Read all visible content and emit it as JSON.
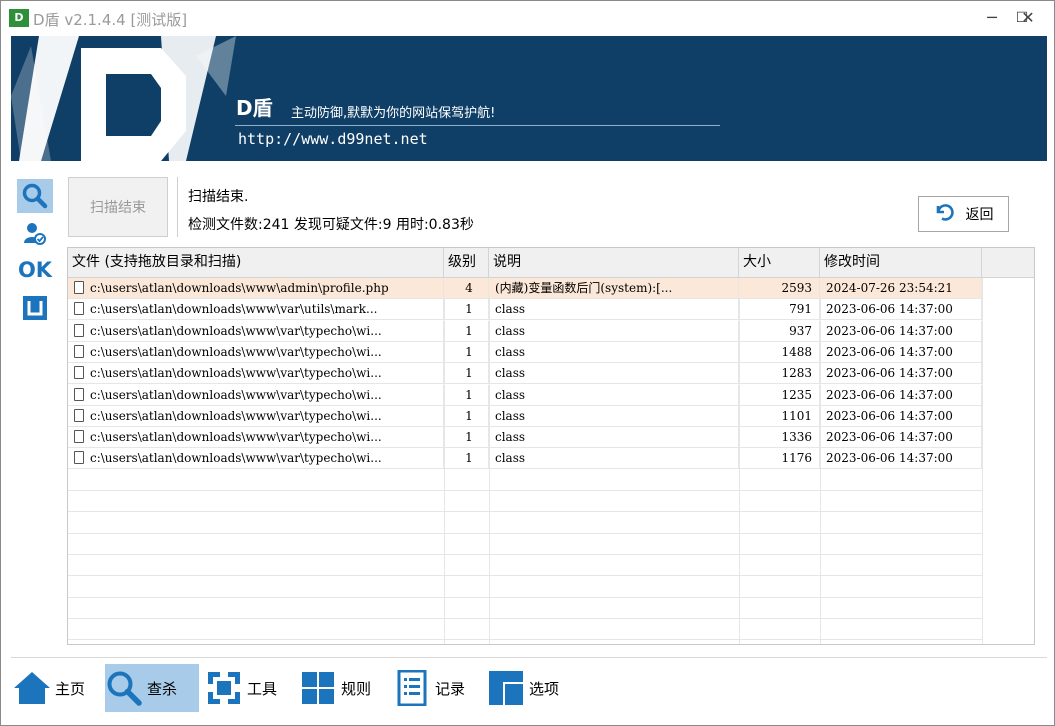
{
  "window": {
    "icon_text": "D",
    "title": "D盾 v2.1.4.4 [测试版]",
    "minimize": "─",
    "maximize": "☐",
    "close": "✕"
  },
  "banner": {
    "brand": "D盾",
    "slogan": "主动防御,默默为你的网站保驾护航!",
    "url": "http://www.d99net.net",
    "logo_letter": "D"
  },
  "side_icons": [
    "search-icon",
    "user-icon",
    "ok-icon",
    "bracket-icon"
  ],
  "side_ok_text": "OK",
  "scan": {
    "button_label": "扫描结束",
    "status_line1": "扫描结束.",
    "status_line2": "检测文件数:241 发现可疑文件:9 用时:0.83秒",
    "return_label": "返回"
  },
  "table": {
    "columns": [
      "文件 (支持拖放目录和扫描)",
      "级别",
      "说明",
      "大小",
      "修改时间"
    ],
    "rows": [
      {
        "file": "c:\\users\\atlan\\downloads\\www\\admin\\profile.php",
        "level": "4",
        "desc": "(内藏)变量函数后门(system):[...",
        "size": "2593",
        "mtime": "2024-07-26 23:54:21"
      },
      {
        "file": "c:\\users\\atlan\\downloads\\www\\var\\utils\\mark...",
        "level": "1",
        "desc": "class",
        "size": "791",
        "mtime": "2023-06-06 14:37:00"
      },
      {
        "file": "c:\\users\\atlan\\downloads\\www\\var\\typecho\\wi...",
        "level": "1",
        "desc": "class",
        "size": "937",
        "mtime": "2023-06-06 14:37:00"
      },
      {
        "file": "c:\\users\\atlan\\downloads\\www\\var\\typecho\\wi...",
        "level": "1",
        "desc": "class",
        "size": "1488",
        "mtime": "2023-06-06 14:37:00"
      },
      {
        "file": "c:\\users\\atlan\\downloads\\www\\var\\typecho\\wi...",
        "level": "1",
        "desc": "class",
        "size": "1283",
        "mtime": "2023-06-06 14:37:00"
      },
      {
        "file": "c:\\users\\atlan\\downloads\\www\\var\\typecho\\wi...",
        "level": "1",
        "desc": "class",
        "size": "1235",
        "mtime": "2023-06-06 14:37:00"
      },
      {
        "file": "c:\\users\\atlan\\downloads\\www\\var\\typecho\\wi...",
        "level": "1",
        "desc": "class",
        "size": "1101",
        "mtime": "2023-06-06 14:37:00"
      },
      {
        "file": "c:\\users\\atlan\\downloads\\www\\var\\typecho\\wi...",
        "level": "1",
        "desc": "class",
        "size": "1336",
        "mtime": "2023-06-06 14:37:00"
      },
      {
        "file": "c:\\users\\atlan\\downloads\\www\\var\\typecho\\wi...",
        "level": "1",
        "desc": "class",
        "size": "1176",
        "mtime": "2023-06-06 14:37:00"
      }
    ]
  },
  "nav": [
    {
      "label": "主页",
      "icon": "home-icon",
      "active": false
    },
    {
      "label": "查杀",
      "icon": "search-icon",
      "active": true
    },
    {
      "label": "工具",
      "icon": "tools-icon",
      "active": false
    },
    {
      "label": "规则",
      "icon": "rules-icon",
      "active": false
    },
    {
      "label": "记录",
      "icon": "log-icon",
      "active": false
    },
    {
      "label": "选项",
      "icon": "options-icon",
      "active": false
    }
  ],
  "colors": {
    "banner_bg": "#0f3f66",
    "accent_blue": "#1c75bc",
    "selected_row": "#fbe8d8",
    "active_nav": "#a7cbe8"
  }
}
